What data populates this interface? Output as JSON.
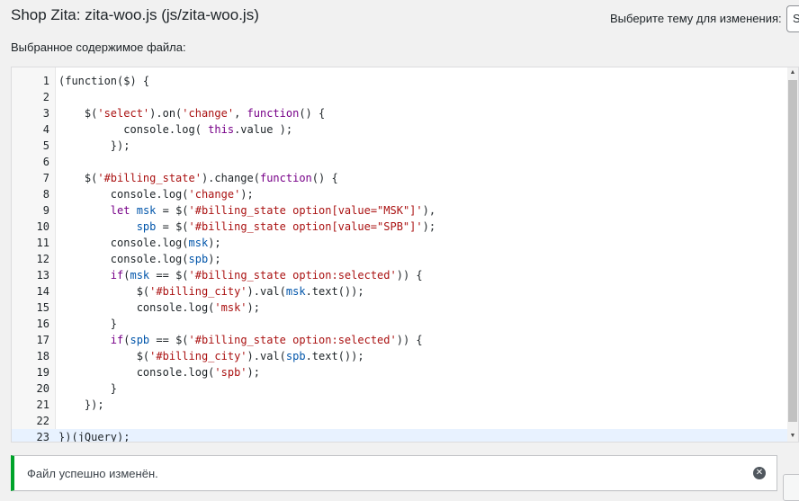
{
  "page": {
    "title": "Shop Zita: zita-woo.js (js/zita-woo.js)",
    "theme_select_label": "Выберите тему для изменения:",
    "theme_select_value": "S",
    "selected_content_label": "Выбранное содержимое файла:"
  },
  "editor": {
    "active_line": 23,
    "lines": [
      {
        "n": "1",
        "html": "(function($) {"
      },
      {
        "n": "2",
        "html": ""
      },
      {
        "n": "3",
        "html": "    $(<span class=\"t-str\">'select'</span>).on(<span class=\"t-str\">'change'</span>, <span class=\"t-kw\">function</span>() {"
      },
      {
        "n": "4",
        "html": "          console.log( <span class=\"t-kw\">this</span>.value );"
      },
      {
        "n": "5",
        "html": "        });"
      },
      {
        "n": "6",
        "html": ""
      },
      {
        "n": "7",
        "html": "    $(<span class=\"t-str\">'#billing_state'</span>).change(<span class=\"t-kw\">function</span>() {"
      },
      {
        "n": "8",
        "html": "        console.log(<span class=\"t-str\">'change'</span>);"
      },
      {
        "n": "9",
        "html": "        <span class=\"t-kw\">let</span> <span class=\"t-var\">msk</span> = $(<span class=\"t-str\">'#billing_state option[value=\"MSK\"]'</span>),"
      },
      {
        "n": "10",
        "html": "            <span class=\"t-var\">spb</span> = $(<span class=\"t-str\">'#billing_state option[value=\"SPB\"]'</span>);"
      },
      {
        "n": "11",
        "html": "        console.log(<span class=\"t-var\">msk</span>);"
      },
      {
        "n": "12",
        "html": "        console.log(<span class=\"t-var\">spb</span>);"
      },
      {
        "n": "13",
        "html": "        <span class=\"t-kw\">if</span>(<span class=\"t-var\">msk</span> == $(<span class=\"t-str\">'#billing_state option:selected'</span>)) {"
      },
      {
        "n": "14",
        "html": "            $(<span class=\"t-str\">'#billing_city'</span>).val(<span class=\"t-var\">msk</span>.text());"
      },
      {
        "n": "15",
        "html": "            console.log(<span class=\"t-str\">'msk'</span>);"
      },
      {
        "n": "16",
        "html": "        }"
      },
      {
        "n": "17",
        "html": "        <span class=\"t-kw\">if</span>(<span class=\"t-var\">spb</span> == $(<span class=\"t-str\">'#billing_state option:selected'</span>)) {"
      },
      {
        "n": "18",
        "html": "            $(<span class=\"t-str\">'#billing_city'</span>).val(<span class=\"t-var\">spb</span>.text());"
      },
      {
        "n": "19",
        "html": "            console.log(<span class=\"t-str\">'spb'</span>);"
      },
      {
        "n": "20",
        "html": "        }"
      },
      {
        "n": "21",
        "html": "    });"
      },
      {
        "n": "22",
        "html": ""
      },
      {
        "n": "23",
        "html": "})(jQuery);"
      }
    ]
  },
  "notice": {
    "message": "Файл успешно изменён.",
    "dismiss_icon": "✕",
    "accent_color": "#00a32a"
  },
  "scrollbar": {
    "up_icon": "▲",
    "down_icon": "▼"
  }
}
